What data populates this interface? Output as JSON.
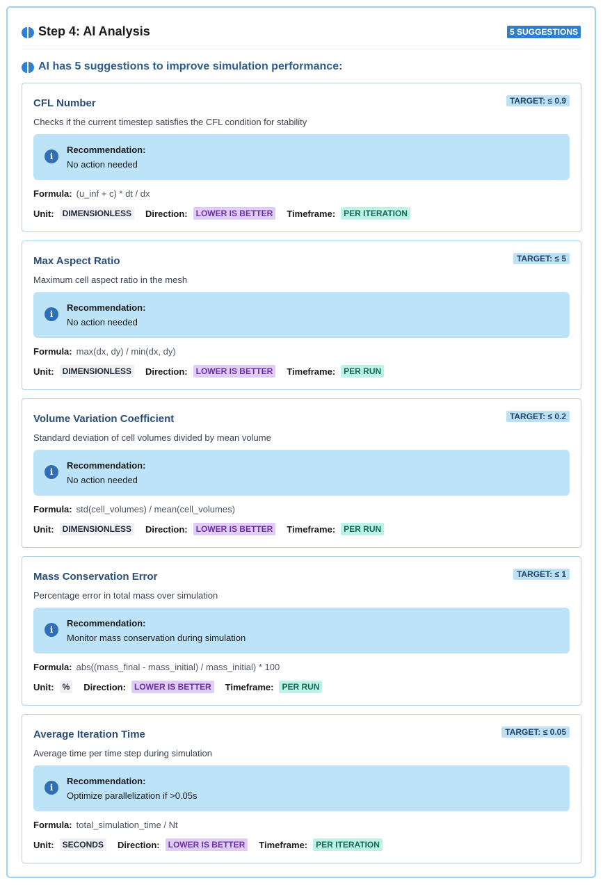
{
  "header": {
    "title": "Step 4: AI Analysis",
    "badge": "5 SUGGESTIONS",
    "icon": "brain-icon"
  },
  "intro": "AI has 5 suggestions to improve simulation performance:",
  "labels": {
    "recommendation": "Recommendation:",
    "formula": "Formula:",
    "unit": "Unit:",
    "direction": "Direction:",
    "timeframe": "Timeframe:"
  },
  "colors": {
    "accent": "#2f80c8",
    "recommendation_bg": "#bde3f8",
    "direction_tag": "#e0cdf6",
    "timeframe_tag": "#bff2e6"
  },
  "cards": [
    {
      "title": "CFL Number",
      "target": "TARGET: ≤ 0.9",
      "description": "Checks if the current timestep satisfies the CFL condition for stability",
      "recommendation": "No action needed",
      "formula": "(u_inf + c) * dt / dx",
      "unit": "DIMENSIONLESS",
      "direction": "LOWER IS BETTER",
      "timeframe": "PER ITERATION"
    },
    {
      "title": "Max Aspect Ratio",
      "target": "TARGET: ≤ 5",
      "description": "Maximum cell aspect ratio in the mesh",
      "recommendation": "No action needed",
      "formula": "max(dx, dy) / min(dx, dy)",
      "unit": "DIMENSIONLESS",
      "direction": "LOWER IS BETTER",
      "timeframe": "PER RUN"
    },
    {
      "title": "Volume Variation Coefficient",
      "target": "TARGET: ≤ 0.2",
      "description": "Standard deviation of cell volumes divided by mean volume",
      "recommendation": "No action needed",
      "formula": "std(cell_volumes) / mean(cell_volumes)",
      "unit": "DIMENSIONLESS",
      "direction": "LOWER IS BETTER",
      "timeframe": "PER RUN"
    },
    {
      "title": "Mass Conservation Error",
      "target": "TARGET: ≤ 1",
      "description": "Percentage error in total mass over simulation",
      "recommendation": "Monitor mass conservation during simulation",
      "formula": "abs((mass_final - mass_initial) / mass_initial) * 100",
      "unit": "%",
      "direction": "LOWER IS BETTER",
      "timeframe": "PER RUN"
    },
    {
      "title": "Average Iteration Time",
      "target": "TARGET: ≤ 0.05",
      "description": "Average time per time step during simulation",
      "recommendation": "Optimize parallelization if >0.05s",
      "formula": "total_simulation_time / Nt",
      "unit": "SECONDS",
      "direction": "LOWER IS BETTER",
      "timeframe": "PER ITERATION"
    }
  ]
}
